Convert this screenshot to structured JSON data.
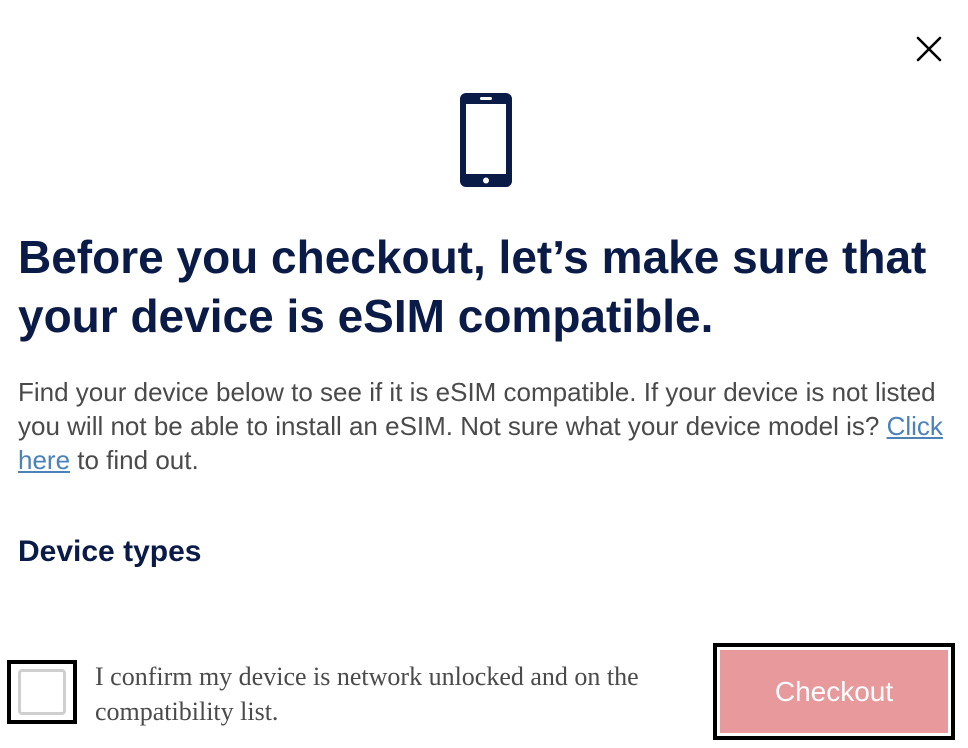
{
  "modal": {
    "close_icon": "close-icon",
    "device_icon": "smartphone-icon",
    "title": "Before you checkout, let’s make sure that your device is eSIM compatible.",
    "intro_before_link": "Find your device below to see if it is eSIM compatible. If your device is not listed you will not be able to install an eSIM. Not sure what your device model is? ",
    "intro_link": "Click here",
    "intro_after_link": " to find out.",
    "section_heading": "Device types",
    "confirm": {
      "checked": false,
      "label": "I confirm my device is network unlocked and on the compatibility list."
    },
    "checkout_label": "Checkout"
  },
  "colors": {
    "navy": "#0b1b48",
    "body_text": "#4a4a4a",
    "link": "#4b82b8",
    "checkout_disabled": "#e8999c"
  }
}
